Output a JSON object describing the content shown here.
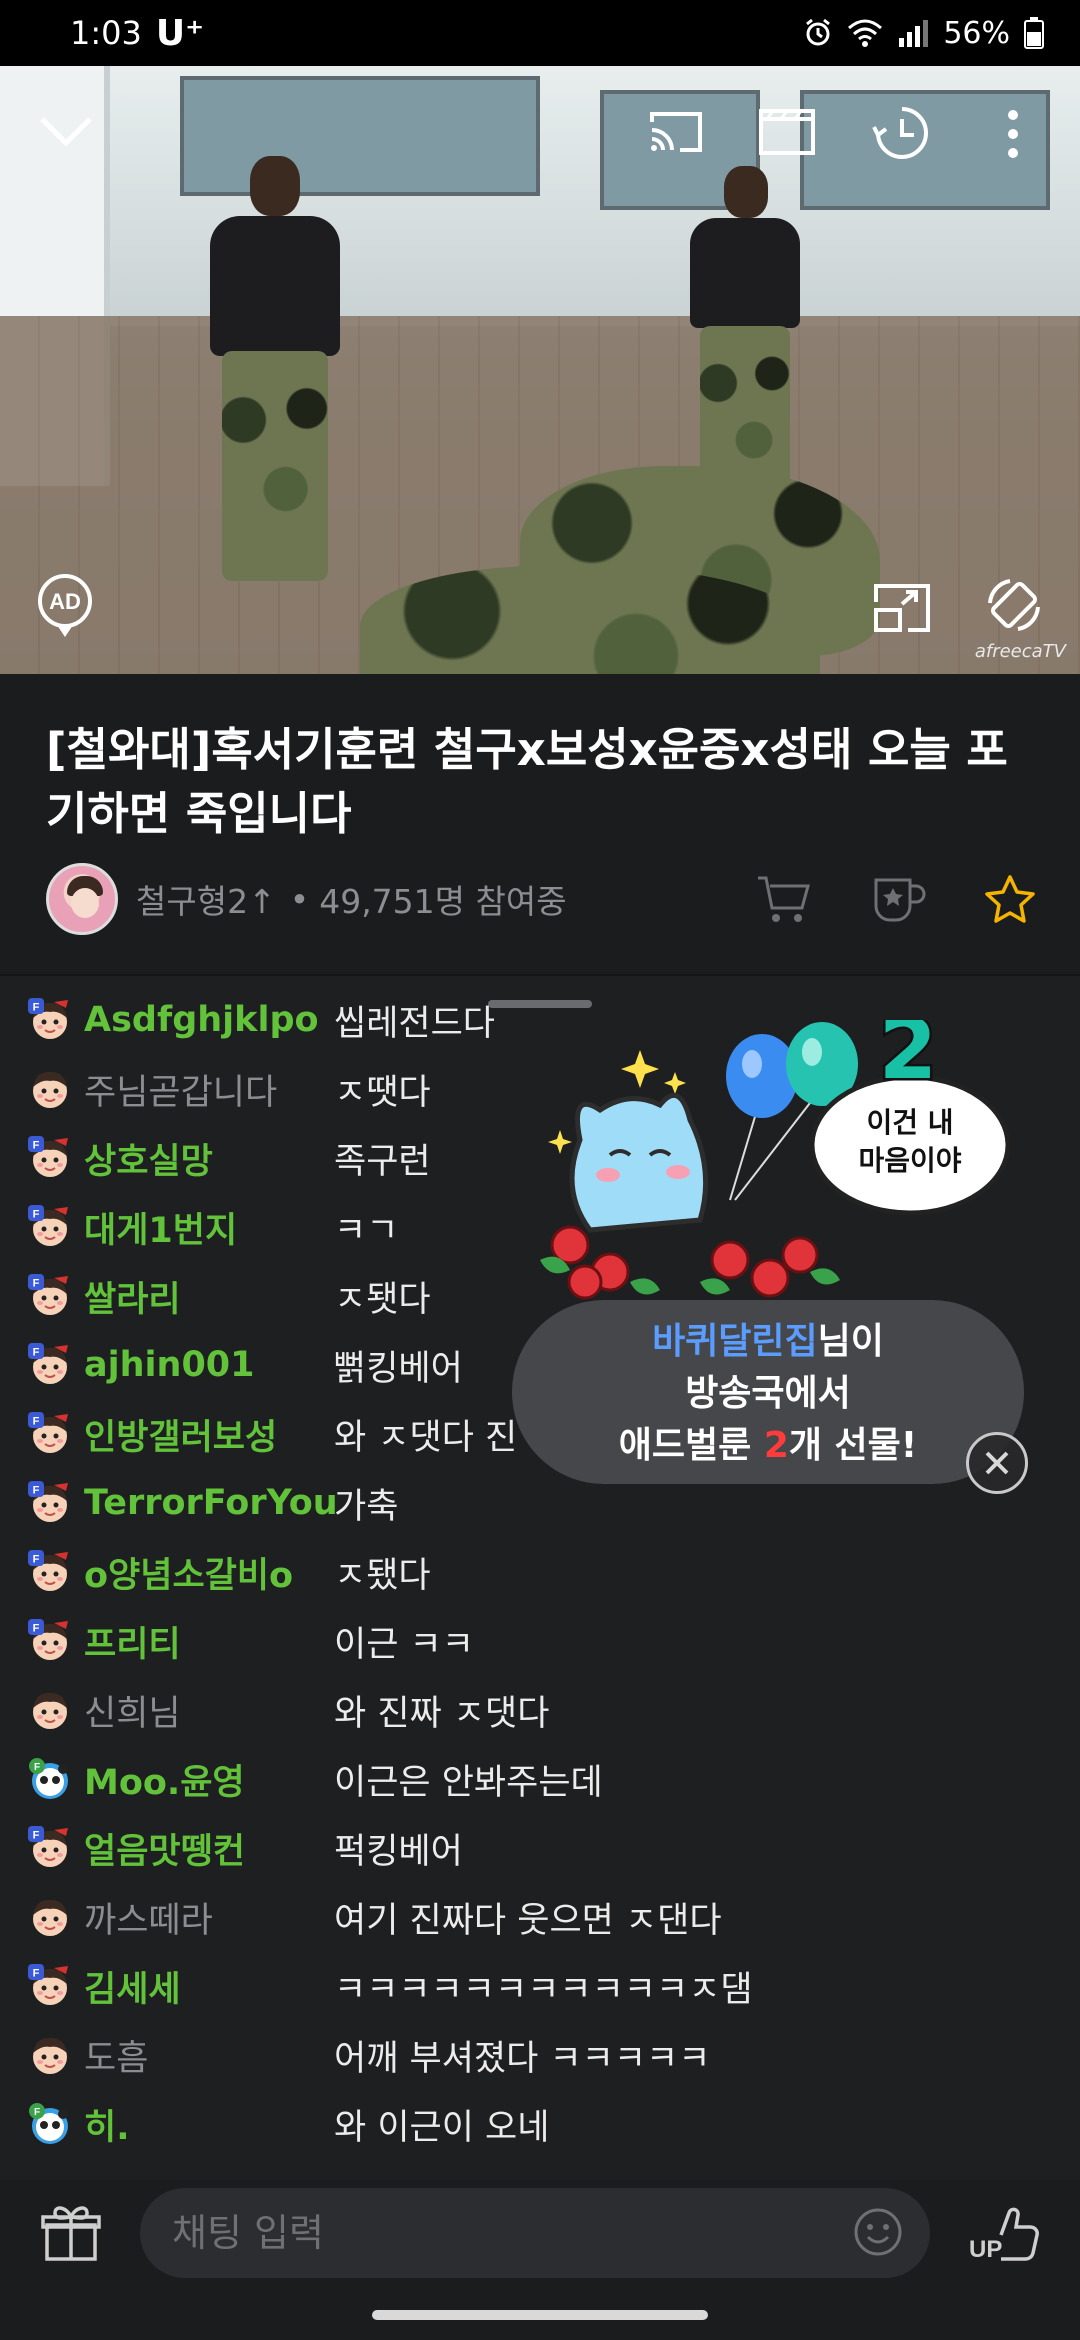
{
  "status_bar": {
    "time": "1:03",
    "carrier": "U⁺",
    "battery": "56%"
  },
  "video": {
    "watermark": "afreecaTV",
    "ad_label": "AD"
  },
  "broadcast": {
    "title": "[철와대]혹서기훈련 철구x보성x윤중x성태 오늘 포기하면 죽입니다",
    "streamer": "철구형2↑",
    "viewers": "49,751명 참여중"
  },
  "chat": {
    "messages": [
      {
        "nick": "Asdfghjklpo",
        "text": "씹레전드다",
        "style": "green",
        "badge": "fan"
      },
      {
        "nick": "주님곧갑니다",
        "text": "ㅈ땟다",
        "style": "gray",
        "badge": "plain"
      },
      {
        "nick": "상호실망",
        "text": "족구런",
        "style": "green",
        "badge": "fan"
      },
      {
        "nick": "대게1번지",
        "text": "ㅋㄱ",
        "style": "green",
        "badge": "fan"
      },
      {
        "nick": "쌀라리",
        "text": "ㅈ됏다",
        "style": "green",
        "badge": "fan"
      },
      {
        "nick": "ajhin001",
        "text": "뻙킹베어",
        "style": "green",
        "badge": "fan"
      },
      {
        "nick": "인방갤러보성",
        "text": "와 ㅈ댓다 진",
        "style": "green",
        "badge": "fan"
      },
      {
        "nick": "TerrorForYou",
        "text": "가축",
        "style": "green",
        "badge": "fan"
      },
      {
        "nick": "o양념소갈비o",
        "text": "ㅈ됐다",
        "style": "green",
        "badge": "fan"
      },
      {
        "nick": "프리티",
        "text": "이근 ㅋㅋ",
        "style": "green",
        "badge": "fan"
      },
      {
        "nick": "신희님",
        "text": "와 진짜 ㅈ댓다",
        "style": "gray",
        "badge": "plain"
      },
      {
        "nick": "Moo.윤영",
        "text": "이근은 안봐주는데",
        "style": "green",
        "badge": "panda"
      },
      {
        "nick": "얼음맛뗑컨",
        "text": "퍽킹베어",
        "style": "green",
        "badge": "fan"
      },
      {
        "nick": "까스떼라",
        "text": "여기 진짜다 웃으면 ㅈ댄다",
        "style": "gray",
        "badge": "plain"
      },
      {
        "nick": "김세세",
        "text": "ㅋㅋㅋㅋㅋㅋㅋㅋㅋㅋㅋㅈ댐",
        "style": "green",
        "badge": "fan"
      },
      {
        "nick": "도흠",
        "text": "어깨 부셔졌다 ㅋㅋㅋㅋㅋ",
        "style": "gray",
        "badge": "plain"
      },
      {
        "nick": "히.",
        "text": "와 이근이 오네",
        "style": "green",
        "badge": "panda"
      }
    ]
  },
  "gift": {
    "count_badge": "2",
    "speech_line1": "이건 내",
    "speech_line2": "마음이야",
    "sender": "바퀴달린집",
    "suffix": "님이",
    "line2": "방송국에서",
    "line3_pre": "애드벌룬 ",
    "count": "2",
    "line3_post": "개 선물!"
  },
  "input": {
    "placeholder": "채팅 입력",
    "up_label": "UP"
  },
  "colors": {
    "green_nick": "#62c23a",
    "gray_nick": "#8b8d91",
    "favorite_star": "#f5b400",
    "sender_blue": "#5b9cff",
    "count_red": "#ff3b3b"
  }
}
